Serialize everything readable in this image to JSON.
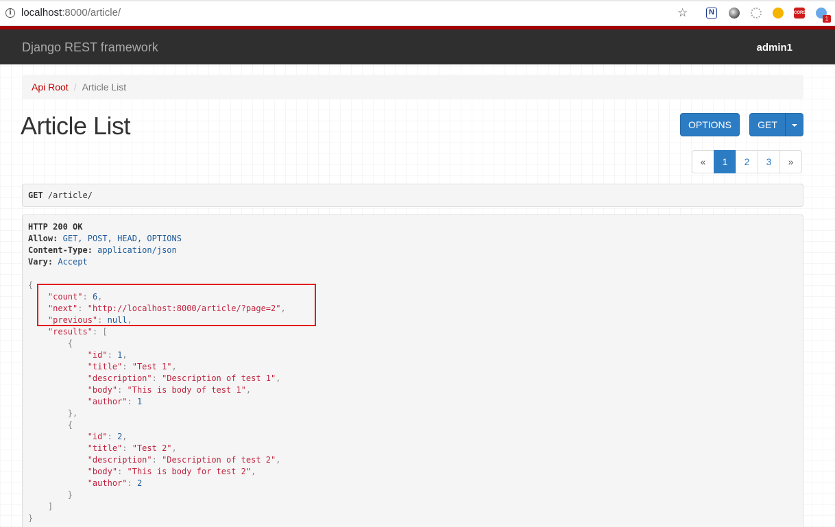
{
  "browser": {
    "url_host": "localhost",
    "url_rest": ":8000/article/",
    "extensions": {
      "n_label": "N",
      "cors_label": "CORS",
      "badge_count": "1"
    }
  },
  "navbar": {
    "brand": "Django REST framework",
    "user": "admin1"
  },
  "breadcrumb": {
    "root": "Api Root",
    "separator": "/",
    "current": "Article List"
  },
  "page_title": "Article List",
  "buttons": {
    "options": "OPTIONS",
    "get": "GET"
  },
  "pagination": {
    "prev": "«",
    "pages": [
      "1",
      "2",
      "3"
    ],
    "next": "»",
    "active": "1"
  },
  "request": {
    "method": "GET",
    "path": "/article/"
  },
  "response": {
    "status": "HTTP 200 OK",
    "allow_label": "Allow:",
    "allow_value": "GET, POST, HEAD, OPTIONS",
    "content_type_label": "Content-Type:",
    "content_type_value": "application/json",
    "vary_label": "Vary:",
    "vary_value": "Accept",
    "body": {
      "count": 6,
      "next": "http://localhost:8000/article/?page=2",
      "previous": "null",
      "results": [
        {
          "id": 1,
          "title": "Test 1",
          "description": "Description of test 1",
          "body": "This is body of test 1",
          "author": 1
        },
        {
          "id": 2,
          "title": "Test 2",
          "description": "Description of test 2",
          "body": "This is body for test 2",
          "author": 2
        }
      ]
    }
  },
  "colors": {
    "navbar_bg": "#2f2f2f",
    "nav_redline": "#a40000",
    "button_blue": "#2c7cc4",
    "json_key": "#c0223e",
    "json_number": "#1f5b9a",
    "highlight": "#e41b1b"
  }
}
